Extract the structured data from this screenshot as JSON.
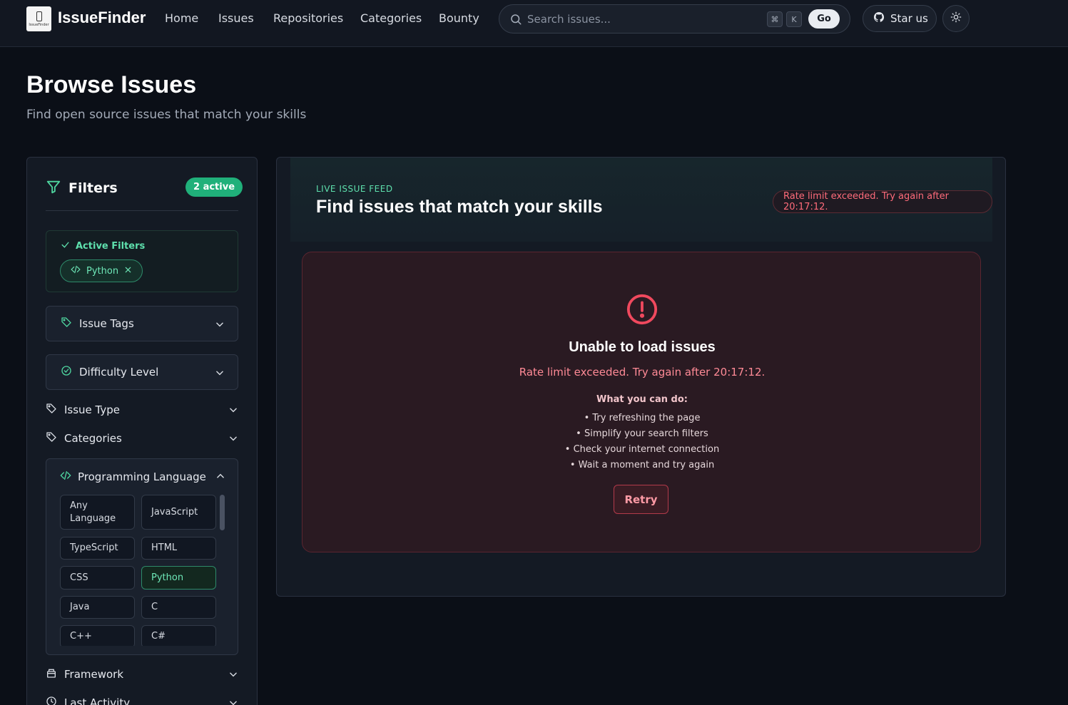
{
  "nav": {
    "logo_text": "IssueFinder",
    "brand": "IssueFinder",
    "links": [
      "Home",
      "Issues",
      "Repositories",
      "Categories",
      "Bounty"
    ],
    "search_placeholder": "Search issues...",
    "kbd_cmd": "⌘",
    "kbd_k": "K",
    "go_label": "Go",
    "star_label": "Star us"
  },
  "header": {
    "title": "Browse Issues",
    "subtitle": "Find open source issues that match your skills"
  },
  "sidebar": {
    "title": "Filters",
    "active_badge": "2 active",
    "active_filters_label": "Active Filters",
    "active_chip": "Python",
    "sections": {
      "issue_tags": "Issue Tags",
      "difficulty": "Difficulty Level",
      "issue_type": "Issue Type",
      "categories": "Categories",
      "programming_language": "Programming Language",
      "framework": "Framework",
      "last_activity": "Last Activity"
    },
    "languages": [
      "Any Language",
      "JavaScript",
      "TypeScript",
      "HTML",
      "CSS",
      "Python",
      "Java",
      "C",
      "C++",
      "C#"
    ],
    "selected_language": "Python"
  },
  "feed": {
    "kicker": "LIVE ISSUE FEED",
    "title": "Find issues that match your skills",
    "rate_badge": "Rate limit exceeded. Try again after 20:17:12.",
    "error": {
      "title": "Unable to load issues",
      "message": "Rate limit exceeded. Try again after 20:17:12.",
      "sub_title": "What you can do:",
      "tips": [
        "• Try refreshing the page",
        "• Simplify your search filters",
        "• Check your internet connection",
        "• Wait a moment and try again"
      ],
      "retry_label": "Retry"
    }
  },
  "colors": {
    "accent": "#20b07a",
    "error": "#ff6b7a",
    "background": "#0b0f17"
  }
}
